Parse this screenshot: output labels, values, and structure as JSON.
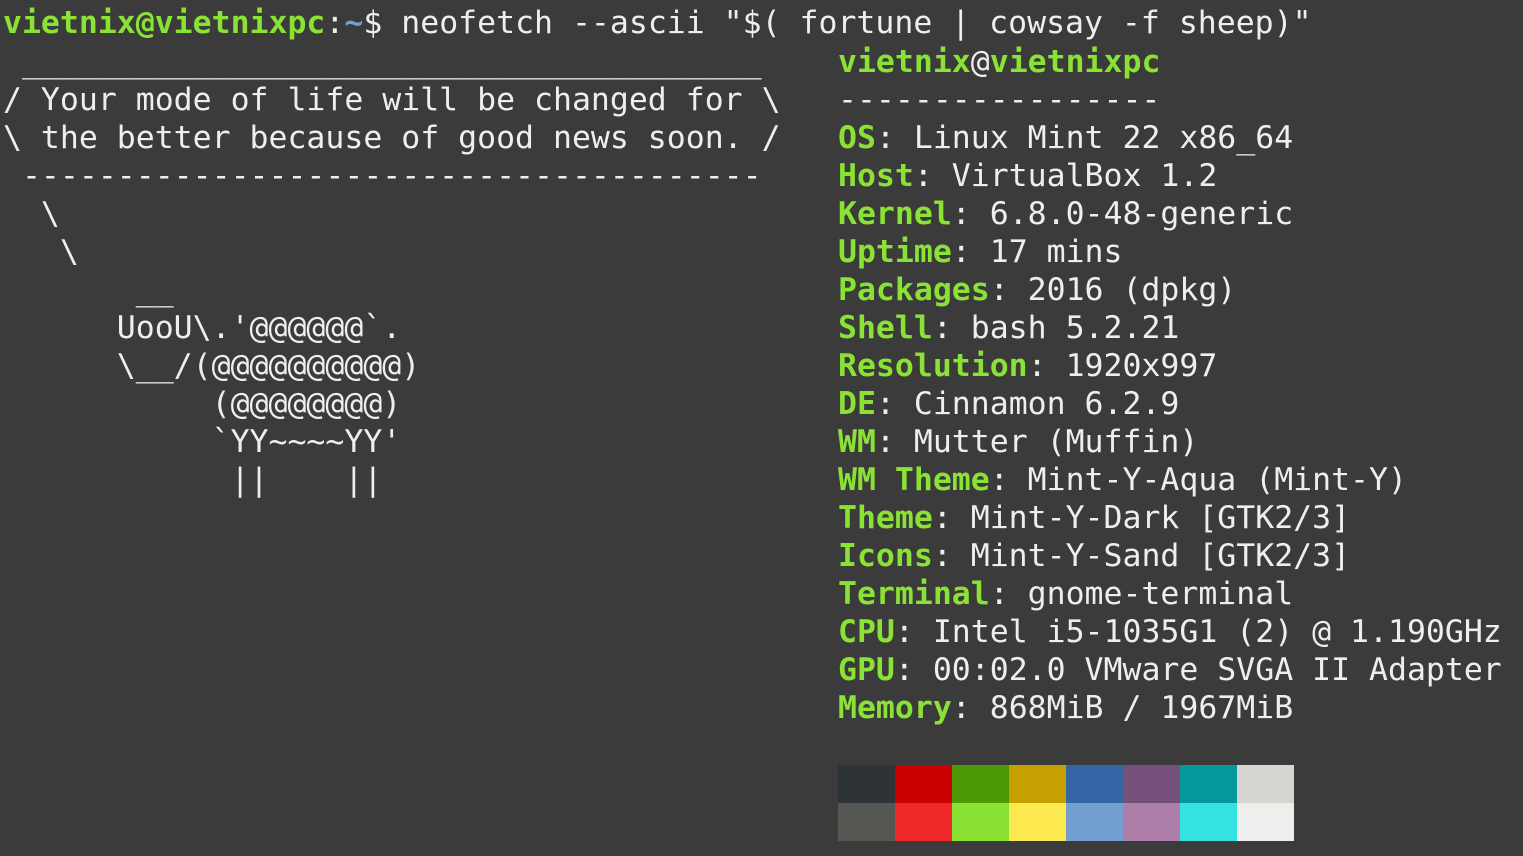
{
  "prompt": {
    "user_host": "vietnix@vietnixpc",
    "colon": ":",
    "path": "~",
    "dollar": "$",
    "command": " neofetch --ascii \"$( fortune | cowsay -f sheep)\""
  },
  "cowsay": {
    "top_border": " _______________________________________",
    "line1": "/ Your mode of life will be changed for \\",
    "line2": "\\ the better because of good news soon. /",
    "bottom_border": " ---------------------------------------",
    "tail1": "  \\",
    "tail2": "   \\",
    "sheep1": "       __",
    "sheep2": "      UooU\\.'@@@@@@`.",
    "sheep3": "      \\__/(@@@@@@@@@@)",
    "sheep4": "           (@@@@@@@@)",
    "sheep5": "           `YY~~~~YY'",
    "sheep6": "            ||    ||"
  },
  "sysinfo": {
    "user_host": "vietnix@vietnixpc",
    "user": "vietnix",
    "at": "@",
    "host": "vietnixpc",
    "separator": "-----------------",
    "rows": [
      {
        "key": "OS",
        "value": ": Linux Mint 22 x86_64"
      },
      {
        "key": "Host",
        "value": ": VirtualBox 1.2"
      },
      {
        "key": "Kernel",
        "value": ": 6.8.0-48-generic"
      },
      {
        "key": "Uptime",
        "value": ": 17 mins"
      },
      {
        "key": "Packages",
        "value": ": 2016 (dpkg)"
      },
      {
        "key": "Shell",
        "value": ": bash 5.2.21"
      },
      {
        "key": "Resolution",
        "value": ": 1920x997"
      },
      {
        "key": "DE",
        "value": ": Cinnamon 6.2.9"
      },
      {
        "key": "WM",
        "value": ": Mutter (Muffin)"
      },
      {
        "key": "WM Theme",
        "value": ": Mint-Y-Aqua (Mint-Y)"
      },
      {
        "key": "Theme",
        "value": ": Mint-Y-Dark [GTK2/3]"
      },
      {
        "key": "Icons",
        "value": ": Mint-Y-Sand [GTK2/3]"
      },
      {
        "key": "Terminal",
        "value": ": gnome-terminal"
      },
      {
        "key": "CPU",
        "value": ": Intel i5-1035G1 (2) @ 1.190GHz"
      },
      {
        "key": "GPU",
        "value": ": 00:02.0 VMware SVGA II Adapter"
      },
      {
        "key": "Memory",
        "value": ": 868MiB / 1967MiB"
      }
    ]
  },
  "palette": {
    "normal": [
      "#2e3436",
      "#cc0000",
      "#4e9a06",
      "#c4a000",
      "#3465a4",
      "#75507b",
      "#06989a",
      "#d3d7cf"
    ],
    "bright": [
      "#555753",
      "#ef2929",
      "#8ae234",
      "#fce94f",
      "#729fcf",
      "#ad7fa8",
      "#34e2e2",
      "#eeeeec"
    ]
  },
  "colors": {
    "background": "#3b3b3b",
    "foreground": "#eeeeec",
    "accent_green": "#8ae234",
    "path_blue": "#729fcf"
  }
}
